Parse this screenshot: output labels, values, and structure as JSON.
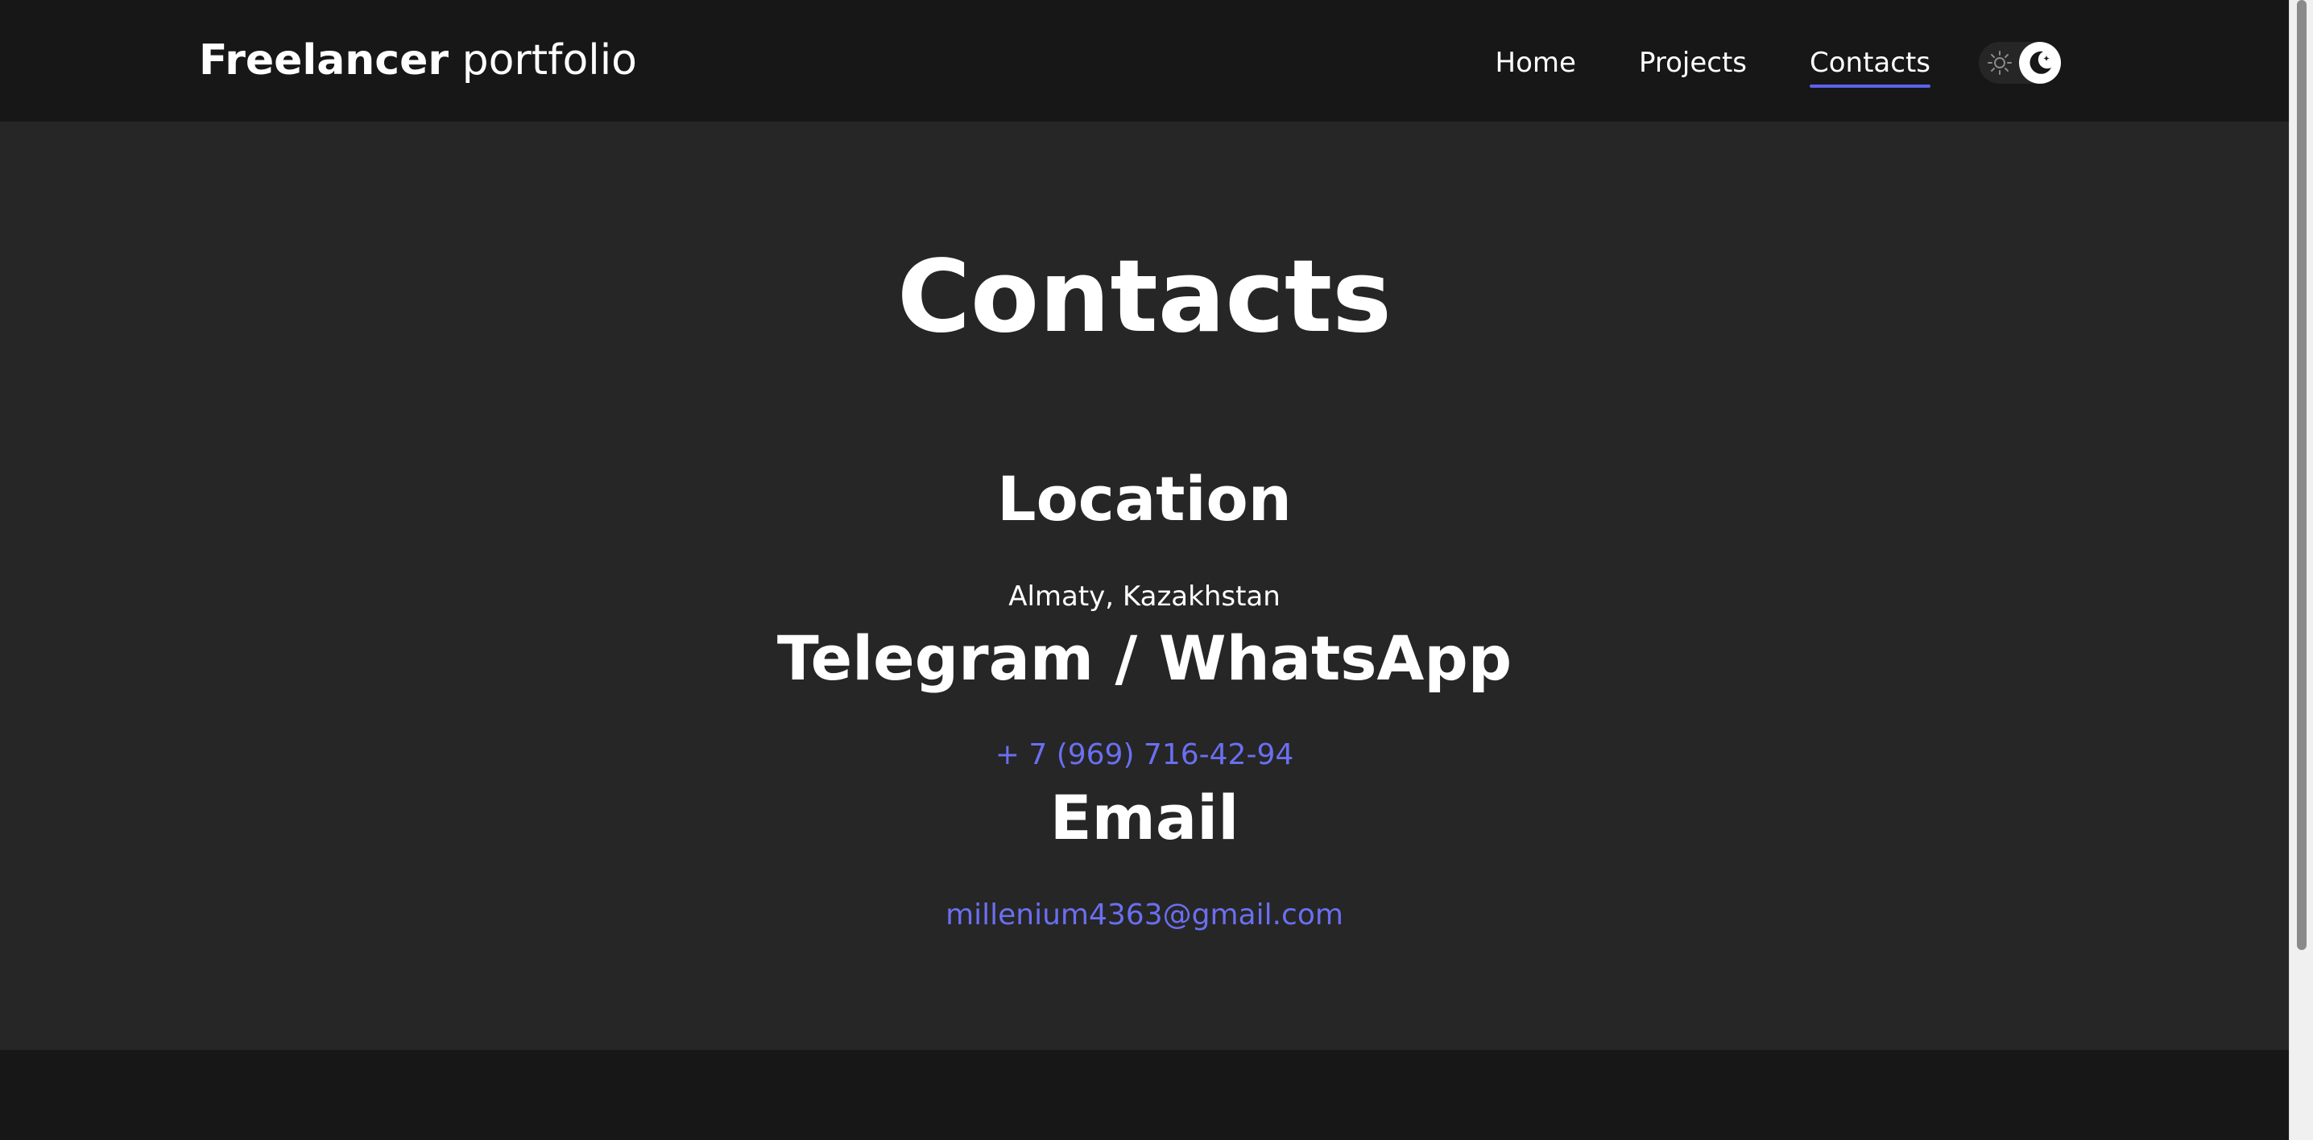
{
  "header": {
    "logo_bold": "Freelancer",
    "logo_light": "portfolio",
    "nav": {
      "home": "Home",
      "projects": "Projects",
      "contacts": "Contacts"
    },
    "active_nav": "Contacts",
    "theme_toggle": {
      "left_icon": "sun-icon",
      "right_icon": "moon-icon",
      "mode": "dark"
    }
  },
  "main": {
    "title": "Contacts",
    "location": {
      "heading": "Location",
      "value": "Almaty, Kazakhstan"
    },
    "messenger": {
      "heading": "Telegram / WhatsApp",
      "value": "+ 7 (969) 716-42-94"
    },
    "email": {
      "heading": "Email",
      "value": "millenium4363@gmail.com"
    }
  },
  "colors": {
    "header_bg": "#171717",
    "main_bg": "#262626",
    "accent": "#5c62ec",
    "link": "#6b6ff0",
    "text": "#ffffff"
  }
}
